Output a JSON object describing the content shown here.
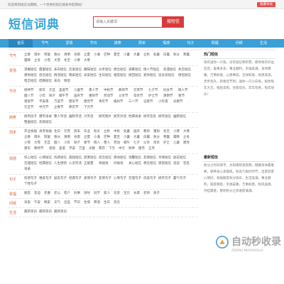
{
  "topbar": {
    "welcome": "欢迎来到短信词典网，一个优秀的短信搜索导航网站！",
    "favorite": "收藏本站"
  },
  "header": {
    "logo": "短信词典",
    "search_placeholder": "请输入关键词",
    "search_button": "搜短信"
  },
  "nav": [
    "首页",
    "节气",
    "爱情",
    "节日",
    "搞笑",
    "周末",
    "情感",
    "句子",
    "祝福",
    "问候",
    "生活"
  ],
  "categories": [
    {
      "name": "节气",
      "links": [
        "立春",
        "雨水",
        "惊蛰",
        "春分",
        "清明",
        "谷雨",
        "立夏",
        "小满",
        "芒种",
        "夏至",
        "小暑",
        "大暑",
        "立秋",
        "处暑",
        "白露",
        "秋分",
        "寒露",
        "霜降",
        "立冬",
        "小雪",
        "大雪",
        "冬至",
        "小寒",
        "大寒"
      ]
    },
    {
      "name": "爱情",
      "links": [
        "求婚短信",
        "甜蜜短信",
        "表白短信",
        "恋爱短信",
        "暧昧短信",
        "分手短信",
        "想念短信",
        "道歉短信",
        "情人节短信",
        "浪漫短信",
        "失恋短信",
        "想你短信",
        "思念短信",
        "情话短信",
        "晚安短信",
        "早安短信",
        "生日短信",
        "相思短信",
        "挽回短信",
        "爱你短信",
        "追女孩短信",
        "情侣短信",
        "暗恋短信",
        "结婚短信",
        "表白",
        "情侣"
      ]
    },
    {
      "name": "节日",
      "links": [
        "财神节",
        "新年",
        "元旦",
        "圣诞节",
        "儿童节",
        "愚人节",
        "中秋节",
        "教师节",
        "元宵节",
        "七夕节",
        "妇女节",
        "情人节",
        "腊八节",
        "小年",
        "除夕",
        "端午节",
        "国庆节",
        "重阳节",
        "劳动节",
        "父亲节",
        "母亲节",
        "护士节",
        "清明节",
        "春节",
        "感恩节",
        "平安夜",
        "万圣节",
        "建军节",
        "建党节",
        "青年节",
        "植树节",
        "三八节",
        "记者节",
        "小年夜",
        "光棍节",
        "元旦节",
        "中元节",
        "立春节",
        "寒衣节",
        "下元节"
      ]
    },
    {
      "name": "搞笑",
      "links": [
        "搞笑段子",
        "爆笑语录",
        "整人笑话",
        "幽默笑话",
        "冷笑话",
        "搞笑图片",
        "搞笑对话",
        "经典语录",
        "搞笑签名",
        "搞笑短信",
        "幽默短信",
        "整蛊短信",
        "恶搞短信"
      ]
    },
    {
      "name": "周末",
      "links": [
        "开业祝福",
        "高考祝福",
        "生日",
        "元宵",
        "周末",
        "毕业",
        "秋天",
        "立秋",
        "中秋",
        "处暑",
        "国庆",
        "教师",
        "重阳",
        "冬至",
        "小寒",
        "大寒",
        "立春",
        "雨水",
        "惊蛰",
        "春分",
        "清明",
        "谷雨",
        "立夏",
        "小满",
        "芒种",
        "夏至",
        "小暑",
        "大暑",
        "白露",
        "秋分",
        "寒露",
        "霜降",
        "立冬",
        "小雪",
        "大雪",
        "元旦",
        "腊八",
        "小年",
        "除夕",
        "春节",
        "情人",
        "愚人",
        "劳动",
        "端午",
        "七夕",
        "父亲",
        "母亲",
        "护士",
        "儿童",
        "建党",
        "建军",
        "教师节",
        "感恩",
        "圣诞",
        "平安",
        "万圣",
        "光棍",
        "寒衣",
        "下元",
        "中元",
        "财神",
        "腊月",
        "正月"
      ]
    },
    {
      "name": "情感",
      "links": [
        "伤心短信",
        "心情短信",
        "伤感短信",
        "孤独短信",
        "寂寞短信",
        "思念短信",
        "感动短信",
        "温馨短信",
        "友情短信",
        "亲情短信",
        "励志短信",
        "哲理短信",
        "经典短信",
        "人生感悟",
        "心灵鸡汤",
        "正能量",
        "祝福语",
        "问候语",
        "关心短信",
        "想念短信",
        "感恩短信",
        "说说",
        "签名",
        "语录"
      ]
    },
    {
      "name": "句子",
      "links": [
        "伤感句子",
        "唯美句子",
        "励志句子",
        "经典句子",
        "爱情句子",
        "友情句子",
        "心情句子",
        "哲理句子",
        "优美句子",
        "搞笑句子",
        "霸气句子",
        "个性句子"
      ]
    },
    {
      "name": "祝福",
      "links": [
        "朋友",
        "友谊",
        "老婆",
        "老公",
        "客户",
        "同事",
        "领导",
        "同学",
        "家人",
        "兄弟",
        "宝贝",
        "长辈",
        "老师",
        "孩子"
      ]
    },
    {
      "name": "问候",
      "links": [
        "早安",
        "午安",
        "晚安",
        "天气",
        "出差",
        "节日",
        "生病",
        "降温",
        "生日",
        "思念"
      ]
    },
    {
      "name": "生活",
      "links": [
        "最新资讯",
        "最新资讯",
        "最新资讯"
      ]
    }
  ],
  "right": {
    "hot_title": "热门短信",
    "hot_text": "兔年送你一只兔，没有短信和钞票，愿你兔年好运连连，喜事多多，事业顺利，幸福美满，身体健康，万事如意，心想事成，吉祥如意，财源滚滚，步步高升。新春佳节到，送你一只小白兔，祝你兔年大吉，福星高照，合家欢乐，年年有余，兔年快乐！",
    "new_title": "最新短信",
    "new_text": "秋分之时日夜平，太阳南移逐渐寒。健康身体最重要，保养身心多锻炼。秋高气爽好时节，出游赏景心情好。祝福朋友秋分快乐，生活美满，事业顺利，家庭和睦，幸福安康，万事如意。秋风送爽，丹桂飘香，愿你秋分之际收获满满。"
  },
  "watermark": {
    "text": "自动秒收录",
    "sub": "ZIDONG MIAOSHOULU"
  }
}
